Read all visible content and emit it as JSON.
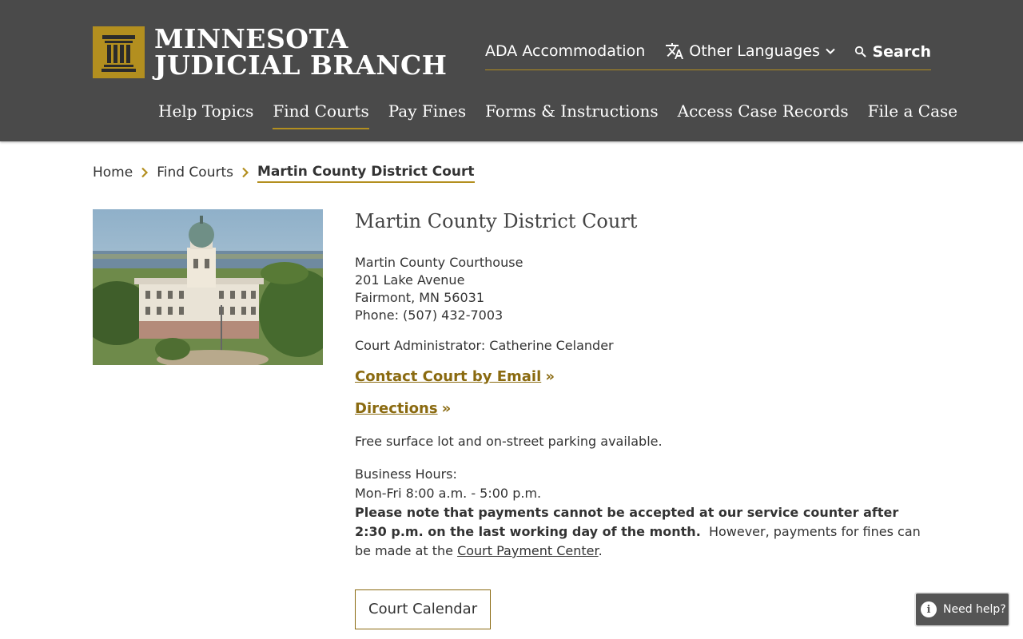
{
  "header": {
    "logo_line1": "MINNESOTA",
    "logo_line2": "JUDICIAL BRANCH",
    "ada_label": "ADA Accommodation",
    "languages_label": "Other Languages",
    "search_label": "Search",
    "nav": [
      {
        "label": "Help Topics"
      },
      {
        "label": "Find Courts"
      },
      {
        "label": "Pay Fines"
      },
      {
        "label": "Forms & Instructions"
      },
      {
        "label": "Access Case Records"
      },
      {
        "label": "File a Case"
      }
    ]
  },
  "breadcrumb": {
    "home": "Home",
    "parent": "Find Courts",
    "current": "Martin County District Court"
  },
  "court": {
    "title": "Martin County District Court",
    "building": "Martin County Courthouse",
    "street": "201 Lake Avenue",
    "city": "Fairmont, MN 56031",
    "phone": "Phone: (507) 432-7003",
    "administrator": "Court Administrator: Catherine Celander",
    "email_link": "Contact Court by Email",
    "directions_link": "Directions",
    "link_suffix": "»",
    "parking": "Free surface lot and on-street parking available.",
    "hours_label": "Business Hours:",
    "hours_value": "Mon-Fri 8:00 a.m. - 5:00 p.m.",
    "notice_bold": "Please note that payments cannot be accepted at our service counter after 2:30 p.m. on the last working day of the month.",
    "notice_text": "However, payments for fines can be made at the",
    "payment_link": "Court Payment Center",
    "notice_end": ".",
    "calendar_button": "Court Calendar"
  },
  "help_widget": {
    "label": "Need help?"
  },
  "colors": {
    "header_bg": "#4a4a4a",
    "accent_gold": "#b38f1f",
    "link_gold": "#8a6a10"
  }
}
